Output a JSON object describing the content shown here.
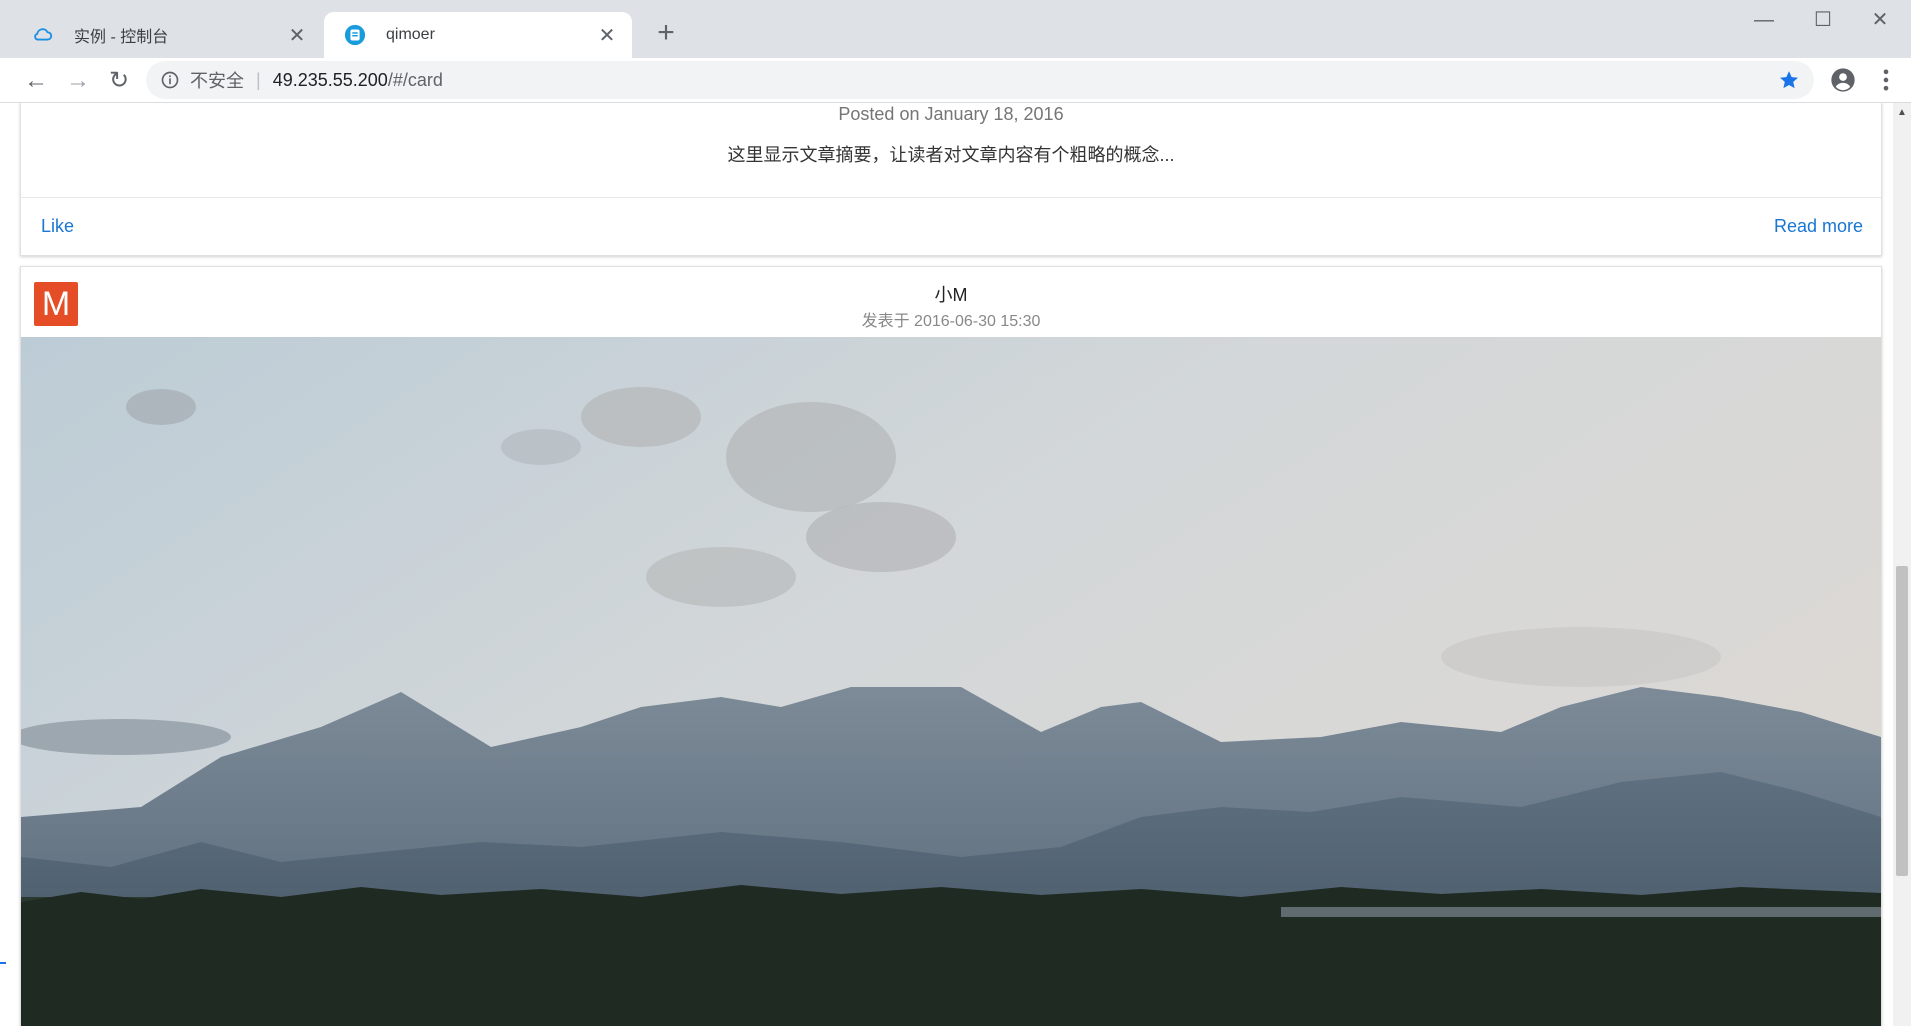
{
  "tabs": [
    {
      "title": "实例 - 控制台",
      "icon": "cloud-icon",
      "active": false
    },
    {
      "title": "qimoer",
      "icon": "site-icon",
      "active": true
    }
  ],
  "toolbar": {
    "insecure_label": "不安全",
    "separator": "|",
    "url_host": "49.235.55.200",
    "url_path": "/#/card"
  },
  "card_top": {
    "posted": "Posted on January 18, 2016",
    "summary": "这里显示文章摘要，让读者对文章内容有个粗略的概念...",
    "like_label": "Like",
    "readmore_label": "Read more"
  },
  "card_post": {
    "avatar_letter": "M",
    "author": "小M",
    "date": "发表于 2016-06-30 15:30"
  },
  "colors": {
    "link": "#1976d2",
    "avatar": "#e44d26"
  }
}
